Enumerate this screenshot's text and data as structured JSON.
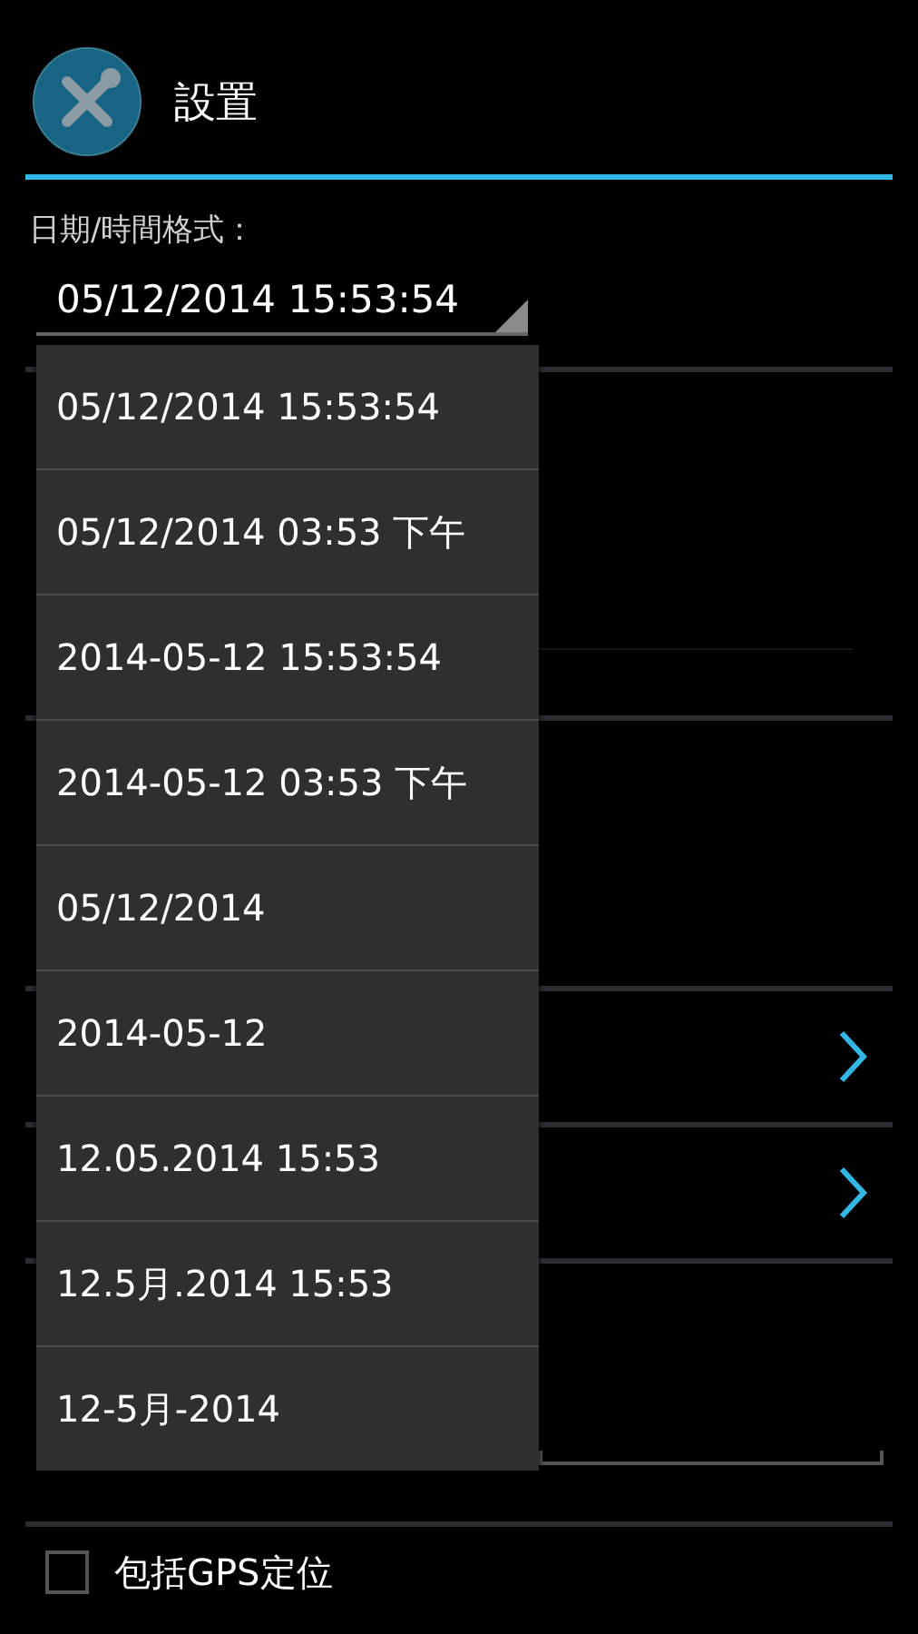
{
  "header": {
    "title": "設置"
  },
  "date_format": {
    "label": "日期/時間格式：",
    "value": "05/12/2014 15:53:54"
  },
  "dropdown": {
    "options": [
      "05/12/2014 15:53:54",
      "05/12/2014 03:53 下午",
      "2014-05-12 15:53:54",
      "2014-05-12 03:53 下午",
      "05/12/2014",
      "2014-05-12",
      "12.05.2014 15:53",
      "12.5月.2014 15:53",
      "12-5月-2014"
    ]
  },
  "gps_option": {
    "label": "包括GPS定位",
    "checked": false
  }
}
